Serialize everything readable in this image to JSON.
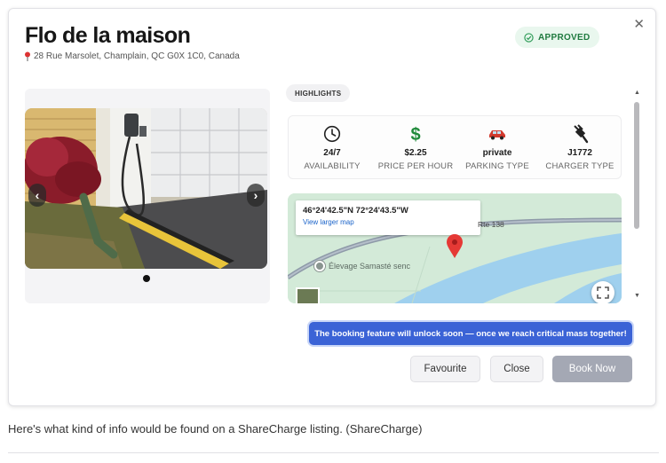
{
  "listing": {
    "title": "Flo de la maison",
    "address": "28 Rue Marsolet, Champlain, QC G0X 1C0, Canada",
    "status": "APPROVED"
  },
  "highlights": {
    "heading": "HIGHLIGHTS",
    "items": [
      {
        "value": "24/7",
        "label": "AVAILABILITY",
        "icon": "clock-icon"
      },
      {
        "value": "$2.25",
        "label": "PRICE PER HOUR",
        "icon": "dollar-icon"
      },
      {
        "value": "private",
        "label": "PARKING TYPE",
        "icon": "car-icon"
      },
      {
        "value": "J1772",
        "label": "CHARGER TYPE",
        "icon": "ev-plug-icon"
      }
    ]
  },
  "map": {
    "coordinates": "46°24'42.5\"N 72°24'43.5\"W",
    "link": "View larger map",
    "road_label": "Rte 138",
    "poi_label": "Élevage Samasté senc"
  },
  "notice": "The booking feature will unlock soon — once we reach critical mass together!",
  "actions": {
    "favourite": "Favourite",
    "close": "Close",
    "book": "Book Now"
  },
  "caption": "Here's what kind of info would be found on a ShareCharge listing. (ShareCharge)",
  "colors": {
    "accent": "#3b63d6",
    "approved_bg": "#e9f7ee",
    "approved_text": "#1f7a3f",
    "disabled_button": "#a4a8b4",
    "map_marker": "#e53935"
  }
}
